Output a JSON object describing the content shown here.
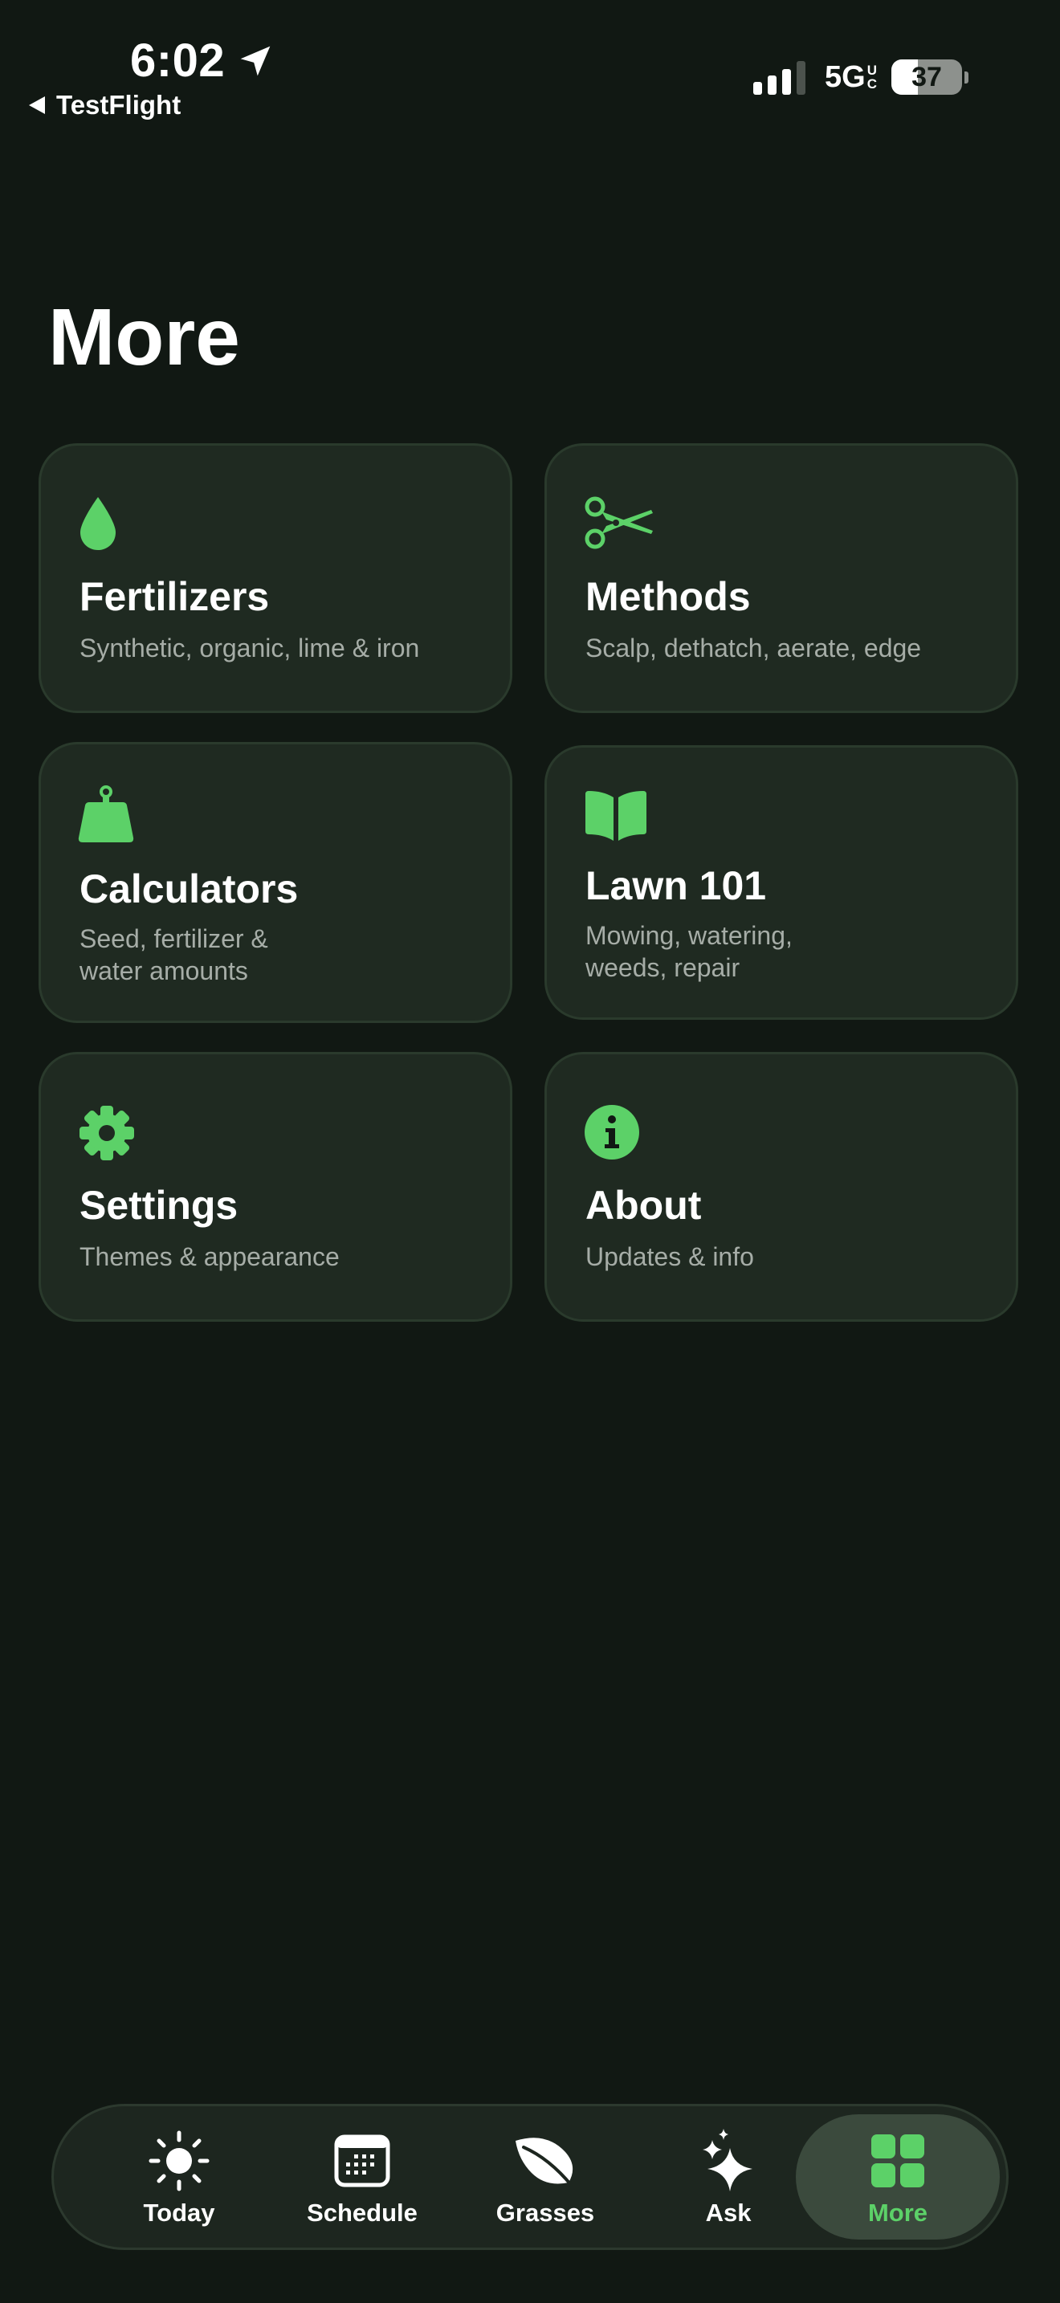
{
  "status_bar": {
    "time": "6:02",
    "back_label": "TestFlight",
    "network": "5G",
    "network_suffix_top": "U",
    "network_suffix_bottom": "C",
    "battery_percent": 37,
    "battery_label": "37"
  },
  "page": {
    "title": "More"
  },
  "colors": {
    "background": "#111813",
    "card": "#1f2a21",
    "accent": "#5cd168",
    "subtitle": "#a6ada7"
  },
  "cards": [
    {
      "title": "Fertilizers",
      "subtitle": "Synthetic, organic, lime & iron",
      "icon": "drop-icon"
    },
    {
      "title": "Methods",
      "subtitle": "Scalp, dethatch, aerate, edge",
      "icon": "scissors-icon"
    },
    {
      "title": "Calculators",
      "subtitle": "Seed, fertilizer &\nwater amounts",
      "icon": "weight-icon"
    },
    {
      "title": "Lawn 101",
      "subtitle": "Mowing, watering,\nweeds, repair",
      "icon": "book-icon"
    },
    {
      "title": "Settings",
      "subtitle": "Themes & appearance",
      "icon": "gear-icon"
    },
    {
      "title": "About",
      "subtitle": "Updates & info",
      "icon": "info-icon"
    }
  ],
  "tabs": [
    {
      "label": "Today",
      "icon": "sun-icon"
    },
    {
      "label": "Schedule",
      "icon": "calendar-icon"
    },
    {
      "label": "Grasses",
      "icon": "leaf-icon"
    },
    {
      "label": "Ask",
      "icon": "sparkles-icon"
    },
    {
      "label": "More",
      "icon": "grid-icon",
      "active": true
    }
  ]
}
